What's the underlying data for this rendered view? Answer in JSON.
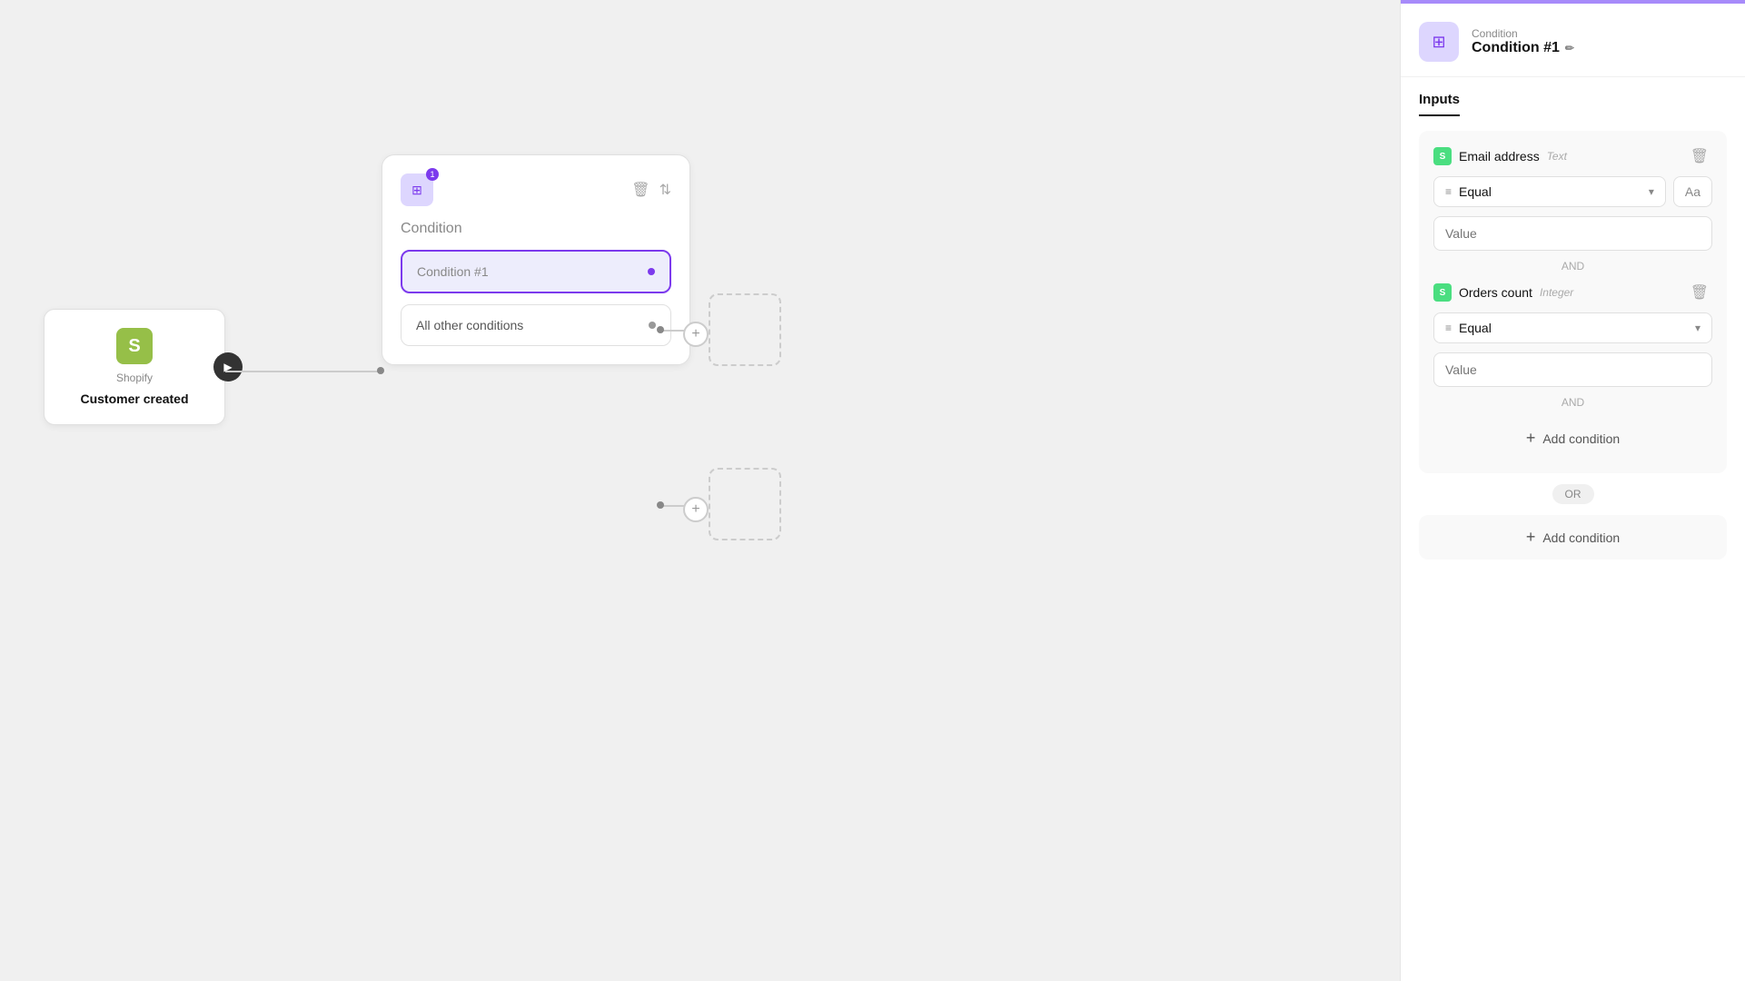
{
  "panel": {
    "top_bar_color": "#a78bfa",
    "header": {
      "label": "Condition",
      "name": "Condition #1",
      "edit_icon": "✏️"
    },
    "inputs_label": "Inputs",
    "condition_group_1": {
      "field_name": "Email address",
      "field_type": "Text",
      "operator_label": "Equal",
      "type_btn_label": "Aa",
      "value_placeholder": "Value",
      "and_label": "AND"
    },
    "condition_group_2": {
      "field_name": "Orders count",
      "field_type": "Integer",
      "operator_label": "Equal",
      "value_placeholder": "Value",
      "and_label": "AND"
    },
    "add_condition_label": "Add condition",
    "or_label": "OR",
    "add_condition_outer_label": "Add condition"
  },
  "canvas": {
    "shopify_node": {
      "logo_char": "S",
      "label": "Shopify",
      "event": "Customer created"
    },
    "condition_node": {
      "title": "Condition",
      "badge_count": "1",
      "branch_1_label": "Condition #1",
      "branch_2_label": "All other conditions"
    }
  },
  "icons": {
    "delete": "🗑",
    "sort": "⇅",
    "plus": "+",
    "chevron_down": "▾",
    "edit": "✏"
  }
}
